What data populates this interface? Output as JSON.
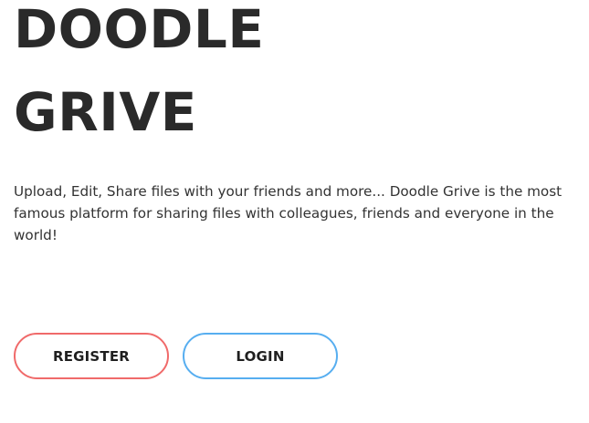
{
  "hero": {
    "title_line_1": "DOODLE",
    "title_line_2": "GRIVE",
    "description": "Upload, Edit, Share files with your friends and more... Doodle Grive is the most famous platform for sharing files with colleagues, friends and everyone in the world!"
  },
  "actions": {
    "register_label": "REGISTER",
    "login_label": "LOGIN"
  },
  "colors": {
    "register_border": "#f06a6a",
    "login_border": "#57aef0",
    "text": "#2a2a2a"
  }
}
